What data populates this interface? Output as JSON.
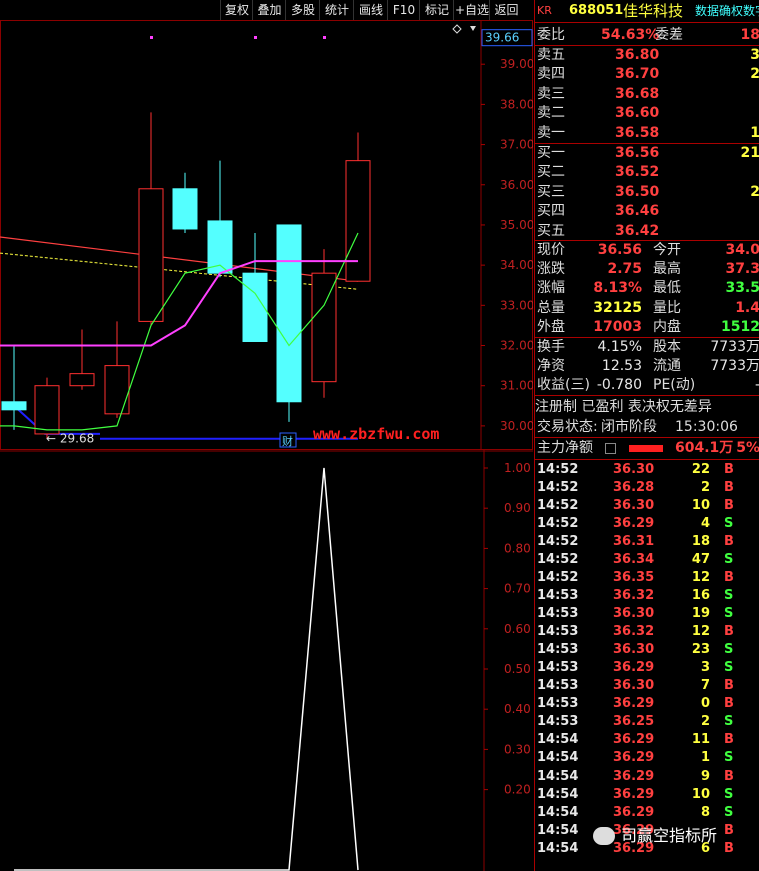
{
  "toolbar": {
    "buttons": [
      "复权",
      "叠加",
      "多股",
      "统计",
      "画线",
      "F10",
      "标记",
      "+自选",
      "返回"
    ]
  },
  "main_chart": {
    "current_price_label": "39.66",
    "y_axis_labels": [
      "39.00",
      "38.00",
      "37.00",
      "36.00",
      "35.00",
      "34.00",
      "33.00",
      "32.00",
      "31.00",
      "30.00"
    ],
    "low_marker": "← 29.68",
    "fin_badge": "财",
    "watermark": "www.zbzfwu.com",
    "colors": {
      "up": "#ff3030",
      "down": "#54ffff",
      "ma_magenta": "#ff40ff",
      "ma_green": "#40ff40",
      "ma_red": "#ff4040",
      "ma_yellow": "#ffff40",
      "low_line": "#2020ff"
    }
  },
  "chart_data": [
    {
      "type": "candlestick",
      "title": "",
      "ylim": [
        29.4,
        40.1
      ],
      "candles": [
        {
          "open": 30.6,
          "close": 30.4,
          "high": 32.0,
          "low": 29.9
        },
        {
          "open": 29.8,
          "close": 31.0,
          "high": 31.2,
          "low": 29.68
        },
        {
          "open": 31.0,
          "close": 31.3,
          "high": 32.4,
          "low": 30.9
        },
        {
          "open": 30.3,
          "close": 31.5,
          "high": 32.6,
          "low": 30.2
        },
        {
          "open": 32.6,
          "close": 35.9,
          "high": 37.8,
          "low": 32.5
        },
        {
          "open": 35.9,
          "close": 34.9,
          "high": 36.3,
          "low": 34.8
        },
        {
          "open": 35.1,
          "close": 33.8,
          "high": 36.6,
          "low": 33.7
        },
        {
          "open": 33.8,
          "close": 32.1,
          "high": 34.8,
          "low": 32.1
        },
        {
          "open": 35.0,
          "close": 30.6,
          "high": 35.0,
          "low": 30.1
        },
        {
          "open": 31.1,
          "close": 33.8,
          "high": 34.4,
          "low": 30.7
        },
        {
          "open": 33.6,
          "close": 36.6,
          "high": 37.3,
          "low": 33.6
        }
      ],
      "ma_magenta": [
        32.0,
        32.0,
        32.0,
        32.0,
        32.0,
        32.5,
        33.8,
        34.1,
        34.1,
        34.1,
        34.1
      ],
      "ma_green": [
        30.0,
        29.9,
        29.9,
        30.0,
        32.5,
        33.8,
        34.0,
        33.3,
        32.0,
        33.0,
        34.8
      ],
      "ma_red_start": 34.7,
      "ma_red_end": 33.6,
      "ma_yellow_start": 34.3,
      "ma_yellow_end": 33.4,
      "low_line": 29.68
    },
    {
      "type": "line",
      "title": "",
      "ylim": [
        0,
        1.0
      ],
      "y_ticks": [
        "1.00",
        "0.90",
        "0.80",
        "0.70",
        "0.60",
        "0.50",
        "0.40",
        "0.30",
        "0.20"
      ],
      "values": [
        0,
        0,
        0,
        0,
        0,
        0,
        0,
        0,
        0,
        1.0,
        0
      ]
    }
  ],
  "quote": {
    "market_tag": "KR",
    "code": "688051",
    "name": "佳华科技",
    "header_right": "数据确权数字",
    "weibi_label": "委比",
    "weibi_value": "54.63%",
    "weicha_label": "委差",
    "weicha_value": "18",
    "asks": [
      {
        "label": "卖五",
        "price": "36.80",
        "vol": "3"
      },
      {
        "label": "卖四",
        "price": "36.70",
        "vol": "2"
      },
      {
        "label": "卖三",
        "price": "36.68",
        "vol": ""
      },
      {
        "label": "卖二",
        "price": "36.60",
        "vol": ""
      },
      {
        "label": "卖一",
        "price": "36.58",
        "vol": "1"
      }
    ],
    "bids": [
      {
        "label": "买一",
        "price": "36.56",
        "vol": "21"
      },
      {
        "label": "买二",
        "price": "36.52",
        "vol": ""
      },
      {
        "label": "买三",
        "price": "36.50",
        "vol": "2"
      },
      {
        "label": "买四",
        "price": "36.46",
        "vol": ""
      },
      {
        "label": "买五",
        "price": "36.42",
        "vol": ""
      }
    ],
    "stats": [
      {
        "l1": "现价",
        "v1": "36.56",
        "c1": "red",
        "l2": "今开",
        "v2": "34.0",
        "c2": "red"
      },
      {
        "l1": "涨跌",
        "v1": "2.75",
        "c1": "red",
        "l2": "最高",
        "v2": "37.3",
        "c2": "red"
      },
      {
        "l1": "涨幅",
        "v1": "8.13%",
        "c1": "red",
        "l2": "最低",
        "v2": "33.5",
        "c2": "green"
      },
      {
        "l1": "总量",
        "v1": "32125",
        "c1": "yellow",
        "l2": "量比",
        "v2": "1.4",
        "c2": "red"
      },
      {
        "l1": "外盘",
        "v1": "17003",
        "c1": "red",
        "l2": "内盘",
        "v2": "1512",
        "c2": "green"
      }
    ],
    "stats2": [
      {
        "l1": "换手",
        "v1": "4.15%",
        "c1": "white",
        "l2": "股本",
        "v2": "7733万",
        "c2": "white"
      },
      {
        "l1": "净资",
        "v1": "12.53",
        "c1": "white",
        "l2": "流通",
        "v2": "7733万",
        "c2": "white"
      },
      {
        "l1": "收益(三)",
        "v1": "-0.780",
        "c1": "white",
        "l2": "PE(动)",
        "v2": "-",
        "c2": "white"
      }
    ],
    "reg_line": "注册制 已盈利 表决权无差异",
    "trade_status_label": "交易状态:",
    "trade_status_value": "闭市阶段",
    "trade_time": "15:30:06",
    "main_flow_label": "主力净额",
    "main_flow_value": "604.1万",
    "main_flow_pct": "5%",
    "ticks": [
      {
        "time": "14:52",
        "price": "36.30",
        "vol": "22",
        "dir": "B"
      },
      {
        "time": "14:52",
        "price": "36.28",
        "vol": "2",
        "dir": "B"
      },
      {
        "time": "14:52",
        "price": "36.30",
        "vol": "10",
        "dir": "B"
      },
      {
        "time": "14:52",
        "price": "36.29",
        "vol": "4",
        "dir": "S"
      },
      {
        "time": "14:52",
        "price": "36.31",
        "vol": "18",
        "dir": "B"
      },
      {
        "time": "14:52",
        "price": "36.34",
        "vol": "47",
        "dir": "S"
      },
      {
        "time": "14:52",
        "price": "36.35",
        "vol": "12",
        "dir": "B"
      },
      {
        "time": "14:53",
        "price": "36.32",
        "vol": "16",
        "dir": "S"
      },
      {
        "time": "14:53",
        "price": "36.30",
        "vol": "19",
        "dir": "S"
      },
      {
        "time": "14:53",
        "price": "36.32",
        "vol": "12",
        "dir": "B"
      },
      {
        "time": "14:53",
        "price": "36.30",
        "vol": "23",
        "dir": "S"
      },
      {
        "time": "14:53",
        "price": "36.29",
        "vol": "3",
        "dir": "S"
      },
      {
        "time": "14:53",
        "price": "36.30",
        "vol": "7",
        "dir": "B"
      },
      {
        "time": "14:53",
        "price": "36.29",
        "vol": "0",
        "dir": "B"
      },
      {
        "time": "14:53",
        "price": "36.25",
        "vol": "2",
        "dir": "S"
      },
      {
        "time": "14:54",
        "price": "36.29",
        "vol": "11",
        "dir": "B"
      },
      {
        "time": "14:54",
        "price": "36.29",
        "vol": "1",
        "dir": "S"
      },
      {
        "time": "14:54",
        "price": "36.29",
        "vol": "9",
        "dir": "B"
      },
      {
        "time": "14:54",
        "price": "36.29",
        "vol": "10",
        "dir": "S"
      },
      {
        "time": "14:54",
        "price": "36.29",
        "vol": "8",
        "dir": "S"
      },
      {
        "time": "14:54",
        "price": "36.29",
        "vol": "",
        "dir": "B"
      },
      {
        "time": "14:54",
        "price": "36.29",
        "vol": "6",
        "dir": "B"
      }
    ],
    "wechat_overlay": "司赢空指标所"
  }
}
